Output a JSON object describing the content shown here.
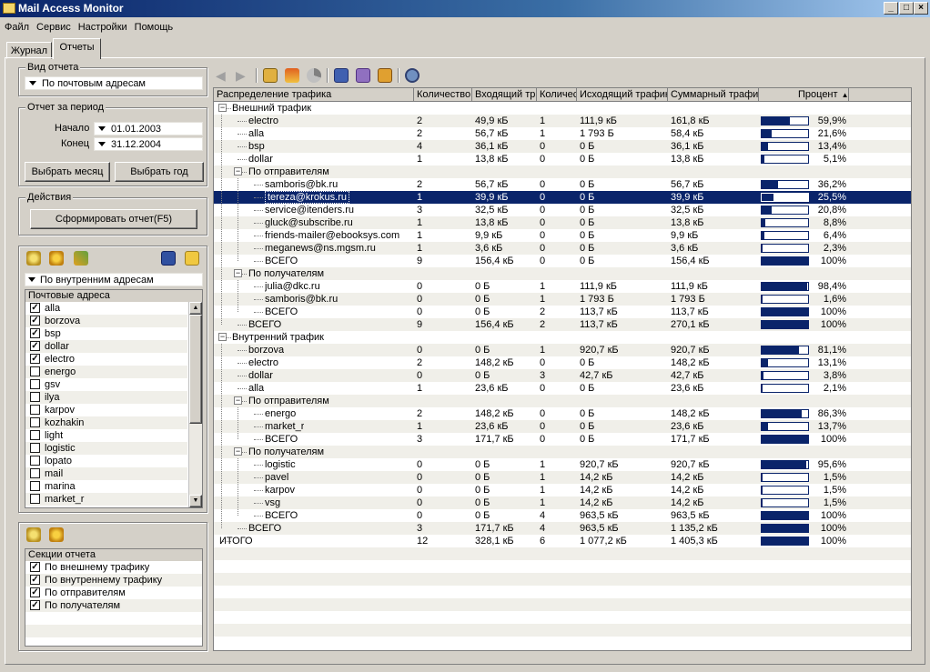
{
  "window": {
    "title": "Mail Access Monitor"
  },
  "menu": [
    "Файл",
    "Сервис",
    "Настройки",
    "Помощь"
  ],
  "tabs": [
    "Журнал",
    "Отчеты"
  ],
  "report_type": {
    "label": "Вид отчета",
    "value": "По почтовым адресам"
  },
  "period": {
    "label": "Отчет за период",
    "start_label": "Начало",
    "start": "01.01.2003",
    "end_label": "Конец",
    "end": "31.12.2004",
    "month_button": "Выбрать месяц",
    "year_button": "Выбрать год"
  },
  "actions": {
    "label": "Действия",
    "generate_button": "Сформировать отчет(F5)"
  },
  "filter": {
    "combo": "По внутренним адресам",
    "list_header": "Почтовые адреса",
    "items": [
      {
        "name": "alla",
        "checked": true
      },
      {
        "name": "borzova",
        "checked": true
      },
      {
        "name": "bsp",
        "checked": true
      },
      {
        "name": "dollar",
        "checked": true
      },
      {
        "name": "electro",
        "checked": true
      },
      {
        "name": "energo",
        "checked": false
      },
      {
        "name": "gsv",
        "checked": false
      },
      {
        "name": "ilya",
        "checked": false
      },
      {
        "name": "karpov",
        "checked": false
      },
      {
        "name": "kozhakin",
        "checked": false
      },
      {
        "name": "light",
        "checked": false
      },
      {
        "name": "logistic",
        "checked": false
      },
      {
        "name": "lopato",
        "checked": false
      },
      {
        "name": "mail",
        "checked": false
      },
      {
        "name": "marina",
        "checked": false
      },
      {
        "name": "market_r",
        "checked": false
      }
    ]
  },
  "sections": {
    "header": "Секции отчета",
    "items": [
      "По внешнему трафику",
      "По внутреннему трафику",
      "По отправителям",
      "По получателям"
    ]
  },
  "grid": {
    "columns": [
      "Распределение трафика",
      "Количество",
      "Входящий тр",
      "Количес",
      "Исходящий трафик",
      "Суммарный трафик",
      "Процент"
    ],
    "rows": [
      {
        "level": 0,
        "expand": "-",
        "name": "Внешний трафик"
      },
      {
        "level": 1,
        "name": "electro",
        "c1": "2",
        "in": "49,9 кБ",
        "c2": "1",
        "out": "111,9 кБ",
        "sum": "161,8 кБ",
        "pct": 59.9,
        "pct_text": "59,9%"
      },
      {
        "level": 1,
        "name": "alla",
        "c1": "2",
        "in": "56,7 кБ",
        "c2": "1",
        "out": "1 793 Б",
        "sum": "58,4 кБ",
        "pct": 21.6,
        "pct_text": "21,6%"
      },
      {
        "level": 1,
        "name": "bsp",
        "c1": "4",
        "in": "36,1 кБ",
        "c2": "0",
        "out": "0 Б",
        "sum": "36,1 кБ",
        "pct": 13.4,
        "pct_text": "13,4%"
      },
      {
        "level": 1,
        "name": "dollar",
        "c1": "1",
        "in": "13,8 кБ",
        "c2": "0",
        "out": "0 Б",
        "sum": "13,8 кБ",
        "pct": 5.1,
        "pct_text": "5,1%"
      },
      {
        "level": 1,
        "expand": "-",
        "name": "По отправителям"
      },
      {
        "level": 2,
        "name": "samboris@bk.ru",
        "c1": "2",
        "in": "56,7 кБ",
        "c2": "0",
        "out": "0 Б",
        "sum": "56,7 кБ",
        "pct": 36.2,
        "pct_text": "36,2%"
      },
      {
        "level": 2,
        "name": "tereza@krokus.ru",
        "c1": "1",
        "in": "39,9 кБ",
        "c2": "0",
        "out": "0 Б",
        "sum": "39,9 кБ",
        "pct": 25.5,
        "pct_text": "25,5%",
        "selected": true
      },
      {
        "level": 2,
        "name": "service@itenders.ru",
        "c1": "3",
        "in": "32,5 кБ",
        "c2": "0",
        "out": "0 Б",
        "sum": "32,5 кБ",
        "pct": 20.8,
        "pct_text": "20,8%"
      },
      {
        "level": 2,
        "name": "gluck@subscribe.ru",
        "c1": "1",
        "in": "13,8 кБ",
        "c2": "0",
        "out": "0 Б",
        "sum": "13,8 кБ",
        "pct": 8.8,
        "pct_text": "8,8%"
      },
      {
        "level": 2,
        "name": "friends-mailer@ebooksys.com",
        "c1": "1",
        "in": "9,9 кБ",
        "c2": "0",
        "out": "0 Б",
        "sum": "9,9 кБ",
        "pct": 6.4,
        "pct_text": "6,4%"
      },
      {
        "level": 2,
        "name": "meganews@ns.mgsm.ru",
        "c1": "1",
        "in": "3,6 кБ",
        "c2": "0",
        "out": "0 Б",
        "sum": "3,6 кБ",
        "pct": 2.3,
        "pct_text": "2,3%"
      },
      {
        "level": 2,
        "name": "ВСЕГО",
        "c1": "9",
        "in": "156,4 кБ",
        "c2": "0",
        "out": "0 Б",
        "sum": "156,4 кБ",
        "pct": 100,
        "pct_text": "100%"
      },
      {
        "level": 1,
        "expand": "-",
        "name": "По получателям"
      },
      {
        "level": 2,
        "name": "julia@dkc.ru",
        "c1": "0",
        "in": "0 Б",
        "c2": "1",
        "out": "111,9 кБ",
        "sum": "111,9 кБ",
        "pct": 98.4,
        "pct_text": "98,4%"
      },
      {
        "level": 2,
        "name": "samboris@bk.ru",
        "c1": "0",
        "in": "0 Б",
        "c2": "1",
        "out": "1 793 Б",
        "sum": "1 793 Б",
        "pct": 1.6,
        "pct_text": "1,6%"
      },
      {
        "level": 2,
        "name": "ВСЕГО",
        "c1": "0",
        "in": "0 Б",
        "c2": "2",
        "out": "113,7 кБ",
        "sum": "113,7 кБ",
        "pct": 100,
        "pct_text": "100%"
      },
      {
        "level": 1,
        "name": "ВСЕГО",
        "c1": "9",
        "in": "156,4 кБ",
        "c2": "2",
        "out": "113,7 кБ",
        "sum": "270,1 кБ",
        "pct": 100,
        "pct_text": "100%"
      },
      {
        "level": 0,
        "expand": "-",
        "name": "Внутренний трафик"
      },
      {
        "level": 1,
        "name": "borzova",
        "c1": "0",
        "in": "0 Б",
        "c2": "1",
        "out": "920,7 кБ",
        "sum": "920,7 кБ",
        "pct": 81.1,
        "pct_text": "81,1%"
      },
      {
        "level": 1,
        "name": "electro",
        "c1": "2",
        "in": "148,2 кБ",
        "c2": "0",
        "out": "0 Б",
        "sum": "148,2 кБ",
        "pct": 13.1,
        "pct_text": "13,1%"
      },
      {
        "level": 1,
        "name": "dollar",
        "c1": "0",
        "in": "0 Б",
        "c2": "3",
        "out": "42,7 кБ",
        "sum": "42,7 кБ",
        "pct": 3.8,
        "pct_text": "3,8%"
      },
      {
        "level": 1,
        "name": "alla",
        "c1": "1",
        "in": "23,6 кБ",
        "c2": "0",
        "out": "0 Б",
        "sum": "23,6 кБ",
        "pct": 2.1,
        "pct_text": "2,1%"
      },
      {
        "level": 1,
        "expand": "-",
        "name": "По отправителям"
      },
      {
        "level": 2,
        "name": "energo",
        "c1": "2",
        "in": "148,2 кБ",
        "c2": "0",
        "out": "0 Б",
        "sum": "148,2 кБ",
        "pct": 86.3,
        "pct_text": "86,3%"
      },
      {
        "level": 2,
        "name": "market_r",
        "c1": "1",
        "in": "23,6 кБ",
        "c2": "0",
        "out": "0 Б",
        "sum": "23,6 кБ",
        "pct": 13.7,
        "pct_text": "13,7%"
      },
      {
        "level": 2,
        "name": "ВСЕГО",
        "c1": "3",
        "in": "171,7 кБ",
        "c2": "0",
        "out": "0 Б",
        "sum": "171,7 кБ",
        "pct": 100,
        "pct_text": "100%"
      },
      {
        "level": 1,
        "expand": "-",
        "name": "По получателям"
      },
      {
        "level": 2,
        "name": "logistic",
        "c1": "0",
        "in": "0 Б",
        "c2": "1",
        "out": "920,7 кБ",
        "sum": "920,7 кБ",
        "pct": 95.6,
        "pct_text": "95,6%"
      },
      {
        "level": 2,
        "name": "pavel",
        "c1": "0",
        "in": "0 Б",
        "c2": "1",
        "out": "14,2 кБ",
        "sum": "14,2 кБ",
        "pct": 1.5,
        "pct_text": "1,5%"
      },
      {
        "level": 2,
        "name": "karpov",
        "c1": "0",
        "in": "0 Б",
        "c2": "1",
        "out": "14,2 кБ",
        "sum": "14,2 кБ",
        "pct": 1.5,
        "pct_text": "1,5%"
      },
      {
        "level": 2,
        "name": "vsg",
        "c1": "0",
        "in": "0 Б",
        "c2": "1",
        "out": "14,2 кБ",
        "sum": "14,2 кБ",
        "pct": 1.5,
        "pct_text": "1,5%"
      },
      {
        "level": 2,
        "name": "ВСЕГО",
        "c1": "0",
        "in": "0 Б",
        "c2": "4",
        "out": "963,5 кБ",
        "sum": "963,5 кБ",
        "pct": 100,
        "pct_text": "100%"
      },
      {
        "level": 1,
        "name": "ВСЕГО",
        "c1": "3",
        "in": "171,7 кБ",
        "c2": "4",
        "out": "963,5 кБ",
        "sum": "1 135,2 кБ",
        "pct": 100,
        "pct_text": "100%"
      },
      {
        "level": 0,
        "name": "ИТОГО",
        "c1": "12",
        "in": "328,1 кБ",
        "c2": "6",
        "out": "1 077,2 кБ",
        "sum": "1 405,3 кБ",
        "pct": 100,
        "pct_text": "100%"
      }
    ]
  },
  "colors": {
    "selection": "#0a246a",
    "bar": "#0a246a",
    "face": "#d4d0c8"
  },
  "icons": [
    "back-icon",
    "forward-icon",
    "report-icon",
    "chart-icon",
    "pie-icon",
    "copy-icon",
    "print-icon",
    "export-icon",
    "search-icon"
  ]
}
